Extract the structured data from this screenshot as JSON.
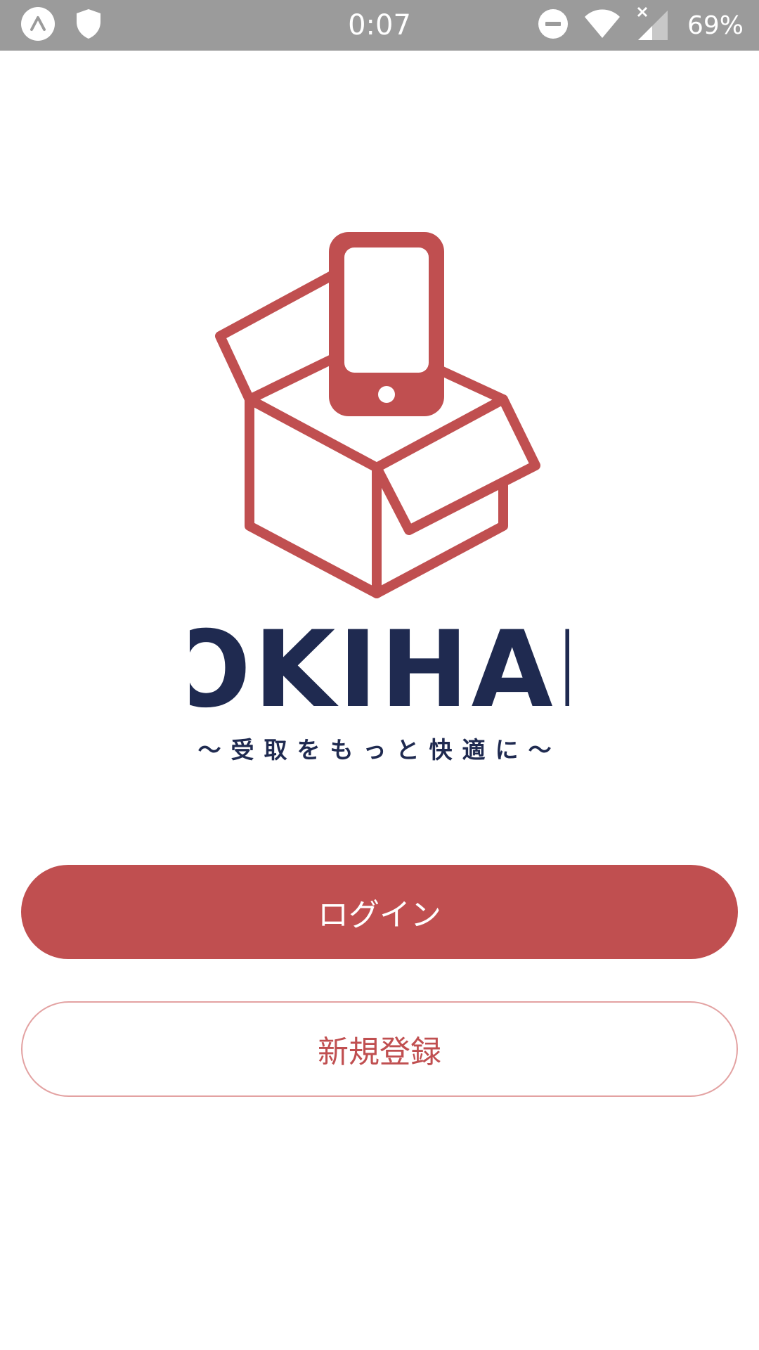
{
  "status_bar": {
    "time": "0:07",
    "battery": "69%",
    "left_icons": [
      "app-launcher-icon",
      "shield-icon"
    ],
    "right_icons": [
      "do-not-disturb-icon",
      "wifi-icon",
      "signal-icon",
      "battery-icon"
    ]
  },
  "brand": {
    "name": "OKIHAI",
    "tagline": "〜受取をもっと快適に〜"
  },
  "actions": {
    "login_label": "ログイン",
    "register_label": "新規登録"
  },
  "colors": {
    "brand_red": "#c04f50",
    "brand_navy": "#1f2a50",
    "status_bar": "#9b9b9b"
  }
}
